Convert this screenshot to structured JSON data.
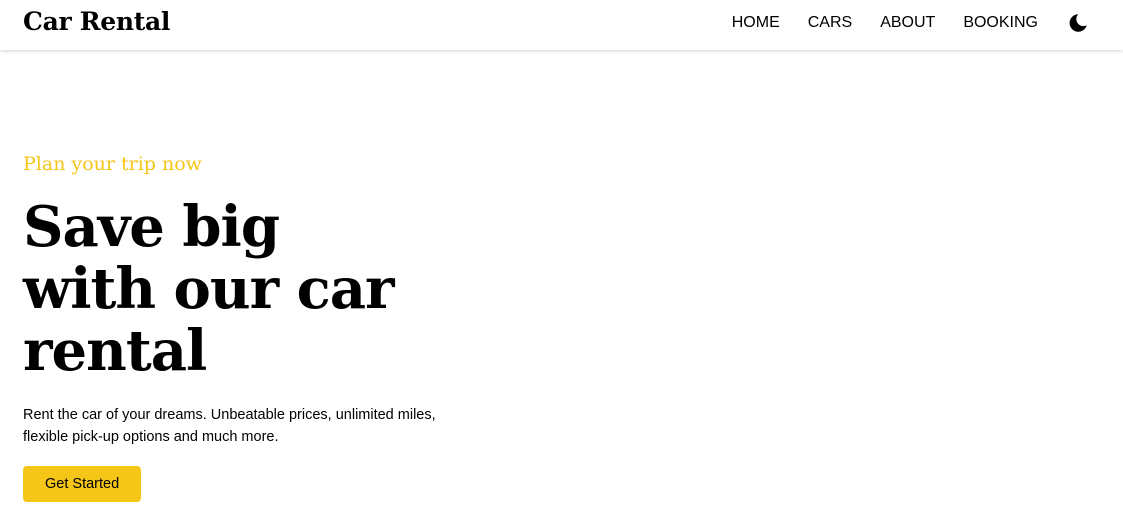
{
  "header": {
    "brand": "Car Rental",
    "nav": [
      "HOME",
      "CARS",
      "ABOUT",
      "BOOKING"
    ],
    "theme_toggle_icon": "moon-icon"
  },
  "hero": {
    "eyebrow": "Plan your trip now",
    "headline_lines": [
      "Save big",
      "with our car",
      "rental"
    ],
    "description": "Rent the car of your dreams. Unbeatable prices, unlimited miles, flexible pick-up options and much more.",
    "cta_label": "Get Started"
  },
  "colors": {
    "accent": "#f5c518",
    "text": "#000000",
    "background": "#ffffff"
  }
}
